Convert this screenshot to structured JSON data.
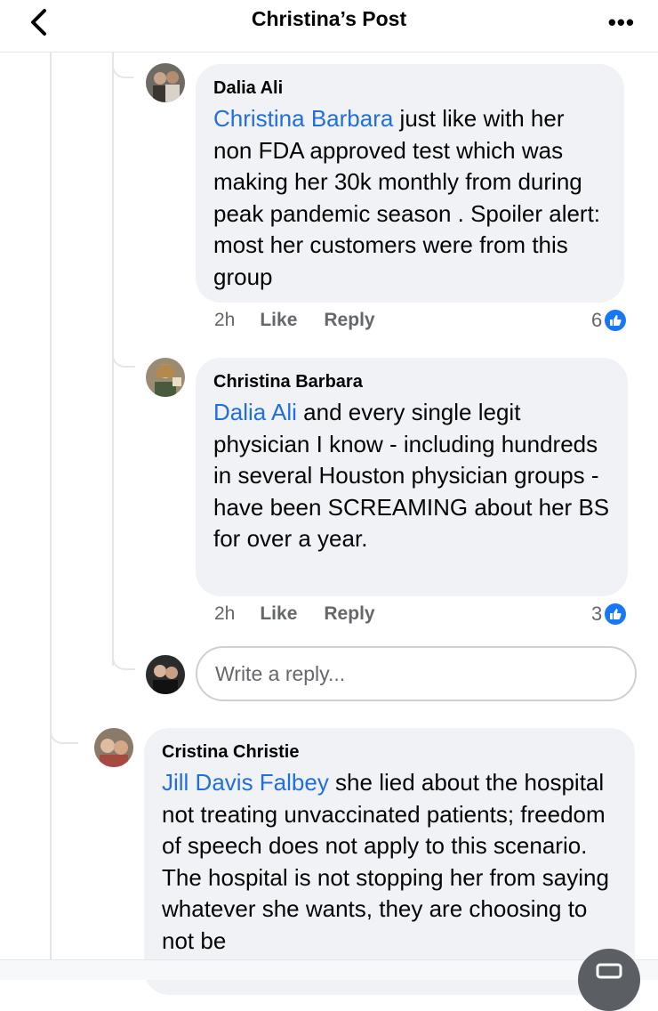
{
  "header": {
    "title": "Christina’s Post",
    "back_icon": "chevron-left-icon",
    "more_label": "•••"
  },
  "comments": [
    {
      "author": "Dalia Ali",
      "mention": "Christina Barbara",
      "text": " just like with her non FDA approved test which was making her 30k monthly from during peak pandemic season . Spoiler alert: most her customers were from this group",
      "time": "2h",
      "like_label": "Like",
      "reply_label": "Reply",
      "reactions": "6"
    },
    {
      "author": "Christina Barbara",
      "mention": "Dalia Ali",
      "text": " and every single legit physician I know - including hundreds in several Houston physician groups - have been SCREAMING about her BS for over a year.",
      "time": "2h",
      "like_label": "Like",
      "reply_label": "Reply",
      "reactions": "3"
    },
    {
      "author": "Cristina Christie",
      "mention": "Jill Davis Falbey",
      "text": " she lied about the hospital not treating unvaccinated patients; freedom of speech does not apply to this scenario. The hospital is not stopping her from saying whatever she wants, they are choosing to not be"
    }
  ],
  "reply_box": {
    "placeholder": "Write a reply..."
  },
  "colors": {
    "mention": "#216fdb",
    "like_blue": "#1877f2",
    "bubble": "#f0f2f5"
  }
}
